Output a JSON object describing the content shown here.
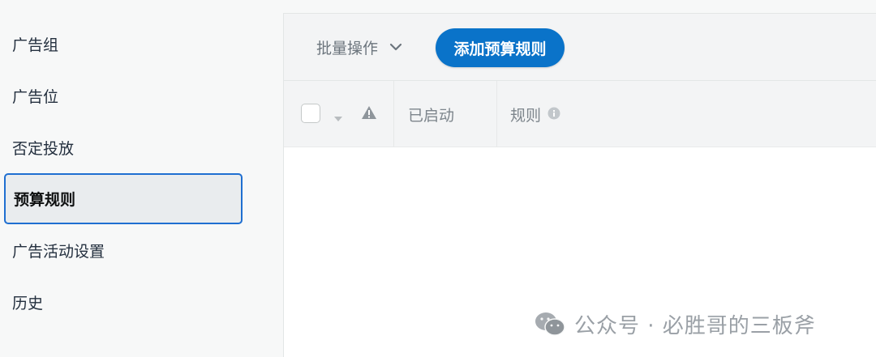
{
  "sidebar": {
    "items": [
      {
        "label": "广告组"
      },
      {
        "label": "广告位"
      },
      {
        "label": "否定投放"
      },
      {
        "label": "预算规则"
      },
      {
        "label": "广告活动设置"
      },
      {
        "label": "历史"
      }
    ],
    "active_index": 3
  },
  "toolbar": {
    "batch_label": "批量操作",
    "add_rule_label": "添加预算规则"
  },
  "table": {
    "columns": {
      "enabled": "已启动",
      "rule": "规则"
    }
  },
  "watermark": {
    "text": "公众号 · 必胜哥的三板斧"
  },
  "colors": {
    "accent": "#0a73c9",
    "active_border": "#1f6fd1",
    "sidebar_bg": "#f7f8f8",
    "header_bg": "#f3f4f5"
  },
  "icons": {
    "batch_dropdown": "chevron-down-icon",
    "select_caret": "caret-down-icon",
    "warning": "warning-icon",
    "info": "info-icon",
    "watermark": "wechat-icon"
  }
}
